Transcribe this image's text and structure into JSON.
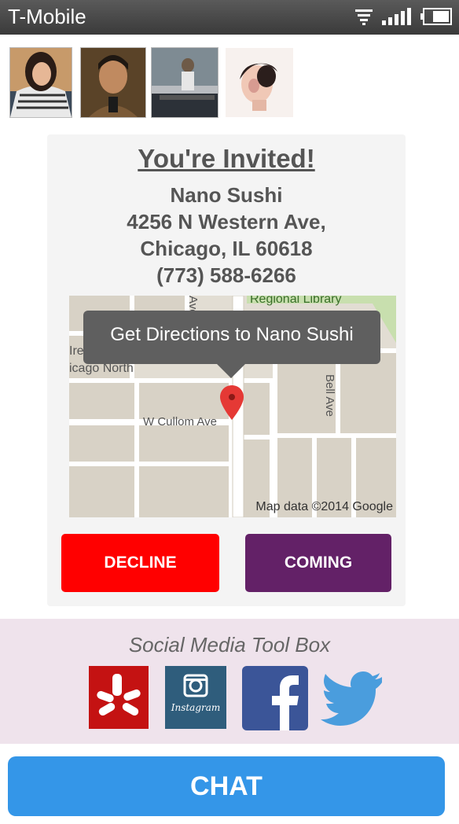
{
  "status_bar": {
    "carrier": "T-Mobile",
    "icons": [
      "wifi-icon",
      "signal-icon",
      "battery-icon"
    ]
  },
  "avatars": [
    "avatar-1",
    "avatar-2",
    "avatar-3",
    "avatar-4"
  ],
  "invite": {
    "title": "You're Invited!",
    "venue": "Nano Sushi",
    "street": "4256 N Western Ave,",
    "city": "Chicago, IL 60618",
    "phone": "(773) 588-6266"
  },
  "map": {
    "tooltip": "Get Directions to Nano Sushi",
    "labels": {
      "regional_library": "Regional Library",
      "chicago_north": "icago North",
      "irv": "Ire",
      "cullom": "W Cullom Ave",
      "bell": "Bell Ave",
      "ave_partial": "Ave"
    },
    "credit": "Map data ©2014 Google",
    "pin_color": "#e53935"
  },
  "actions": {
    "decline": "DECLINE",
    "coming": "COMING",
    "decline_color": "#ff0000",
    "coming_color": "#632167"
  },
  "social": {
    "title": "Social Media Tool Box",
    "icons": [
      "yelp-icon",
      "instagram-icon",
      "facebook-icon",
      "twitter-icon"
    ],
    "instagram_wordmark": "Instagram"
  },
  "chat": {
    "label": "CHAT",
    "color": "#3496e8"
  }
}
